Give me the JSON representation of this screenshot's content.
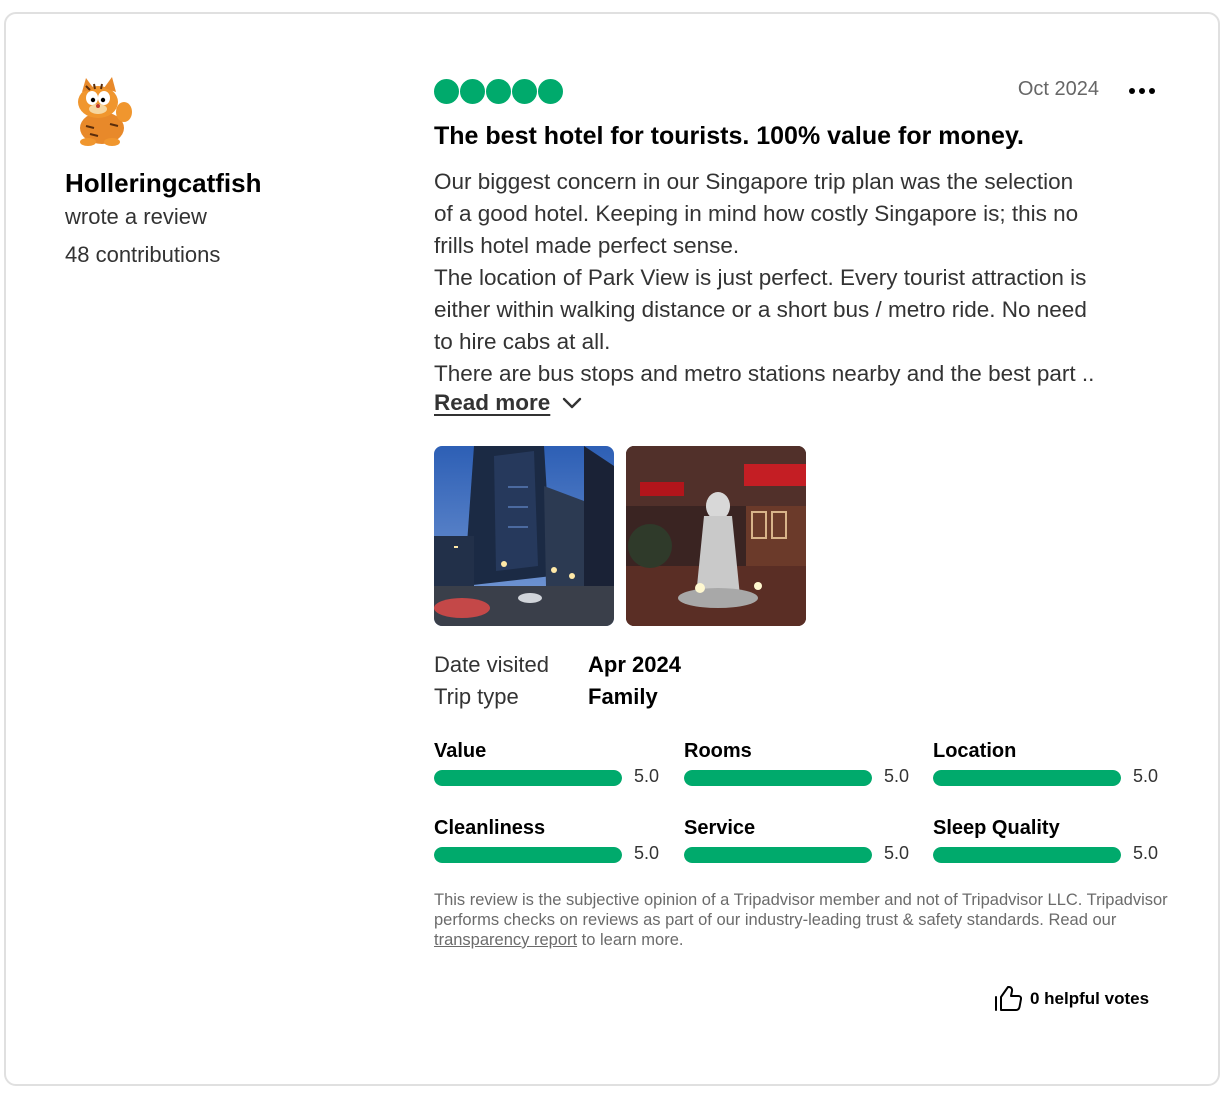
{
  "reviewer": {
    "name": "Holleringcatfish",
    "action": "wrote a review",
    "contributions": "48 contributions",
    "avatar_icon": "garfield-cat-avatar"
  },
  "review": {
    "rating": 5,
    "rating_max": 5,
    "date": "Oct 2024",
    "title": "The best hotel for tourists. 100% value for money.",
    "body_lines": [
      "Our biggest concern in our Singapore trip plan was the selection",
      "of a good hotel. Keeping in mind how costly Singapore is; this no",
      "frills hotel made perfect sense.",
      "The location of Park View is just perfect. Every tourist attraction is",
      "either within walking distance or a short bus / metro ride. No need",
      "to hire cabs at all.",
      "There are bus stops and metro stations nearby and the best part .."
    ],
    "read_more": "Read more",
    "photos": [
      "photo-night-skyscraper-street",
      "photo-statue-chinese-signs"
    ]
  },
  "trip": {
    "date_label": "Date visited",
    "date_value": "Apr 2024",
    "type_label": "Trip type",
    "type_value": "Family"
  },
  "subratings": [
    {
      "label": "Value",
      "score": "5.0",
      "fraction": 1.0
    },
    {
      "label": "Rooms",
      "score": "5.0",
      "fraction": 1.0
    },
    {
      "label": "Location",
      "score": "5.0",
      "fraction": 1.0
    },
    {
      "label": "Cleanliness",
      "score": "5.0",
      "fraction": 1.0
    },
    {
      "label": "Service",
      "score": "5.0",
      "fraction": 1.0
    },
    {
      "label": "Sleep Quality",
      "score": "5.0",
      "fraction": 1.0
    }
  ],
  "disclaimer": {
    "part1": "This review is the subjective opinion of a Tripadvisor member and not of Tripadvisor LLC. Tripadvisor performs checks on reviews as part of our industry-leading trust & safety standards. Read our ",
    "link": "transparency report",
    "part2": " to learn more."
  },
  "helpful": {
    "label": "0 helpful votes"
  },
  "colors": {
    "accent": "#00aa6c",
    "text_secondary": "#333333",
    "muted": "#666666"
  }
}
